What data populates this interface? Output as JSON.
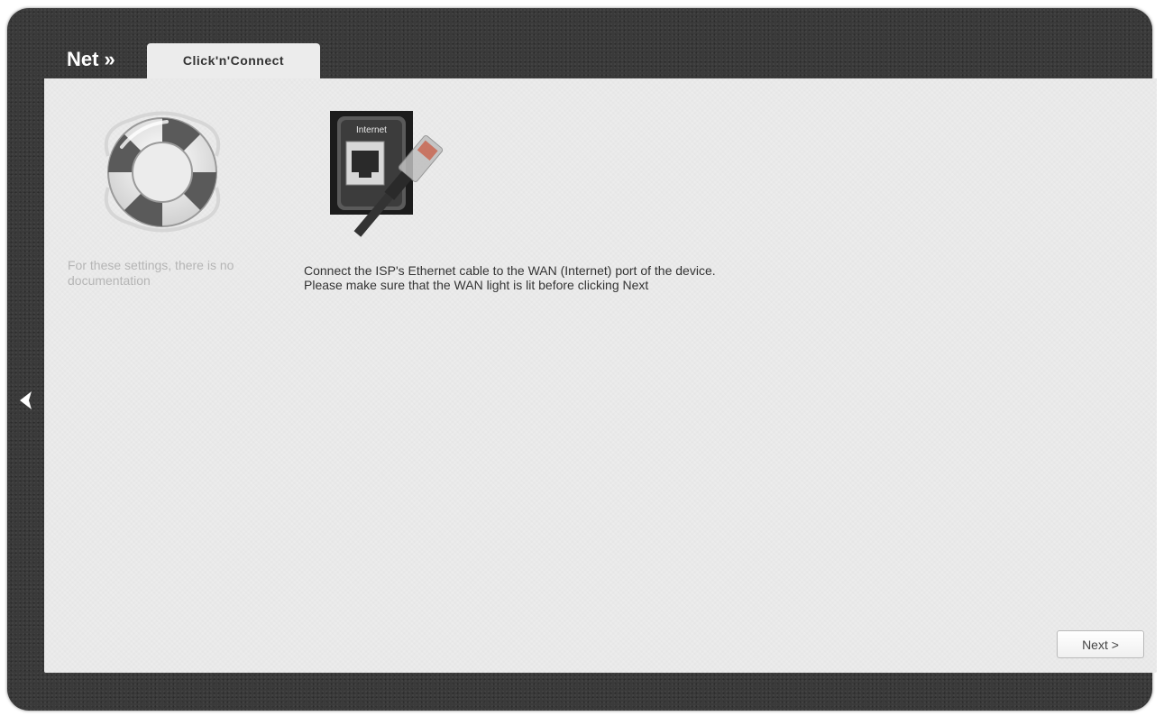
{
  "header": {
    "section_title": "Net »",
    "active_tab": "Click'n'Connect"
  },
  "help": {
    "icon": "lifebuoy-icon",
    "text": "For these settings, there is no documentation"
  },
  "main": {
    "port_image_label": "Internet",
    "instruction_line1": "Connect the ISP's Ethernet cable to the WAN (Internet) port of the device.",
    "instruction_line2": "Please make sure that the WAN light is lit before clicking Next"
  },
  "navigation": {
    "back_icon": "chevron-left-icon"
  },
  "footer": {
    "next_label": "Next >"
  },
  "colors": {
    "frame": "#3a3a3a",
    "panel": "#ececec",
    "text": "#333333",
    "muted_text": "#b5b5b5"
  }
}
